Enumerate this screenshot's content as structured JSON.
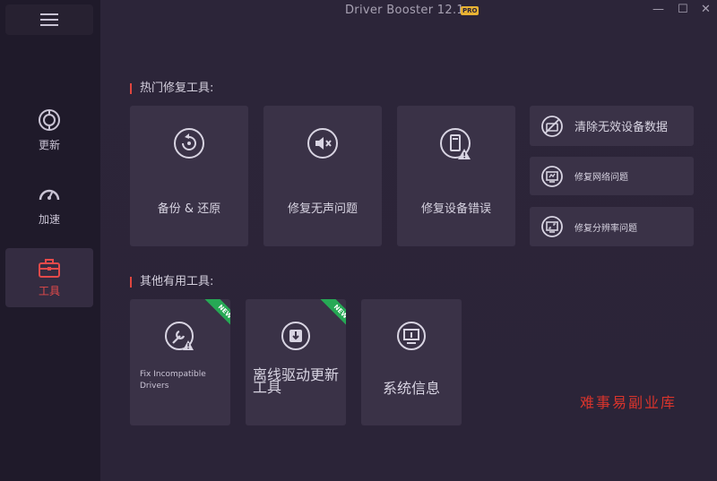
{
  "titlebar": {
    "app_title": "Driver Booster 12.1",
    "pro_badge": "PRO",
    "minimize": "—",
    "maximize": "☐",
    "close": "✕"
  },
  "sidebar": {
    "menu_icon": "hamburger-icon",
    "items": [
      {
        "label": "更新",
        "icon": "update-icon",
        "active": false
      },
      {
        "label": "加速",
        "icon": "speedometer-icon",
        "active": false
      },
      {
        "label": "工具",
        "icon": "toolbox-icon",
        "active": true
      }
    ]
  },
  "sections": {
    "hot_tools_title": "热门修复工具:",
    "other_tools_title": "其他有用工具:"
  },
  "hot_tools": [
    {
      "label": "备份 & 还原",
      "icon": "backup-restore-icon"
    },
    {
      "label": "修复无声问题",
      "icon": "sound-mute-icon"
    },
    {
      "label": "修复设备错误",
      "icon": "device-error-icon"
    }
  ],
  "side_tools": [
    {
      "label": "清除无效设备数据",
      "icon": "clean-device-icon"
    },
    {
      "label": "修复网络问题",
      "icon": "network-fix-icon"
    },
    {
      "label": "修复分辨率问题",
      "icon": "resolution-fix-icon"
    }
  ],
  "other_tools": [
    {
      "label": "Fix Incompatible Drivers",
      "icon": "fix-driver-icon",
      "badge": "NEW"
    },
    {
      "label": "离线驱动更新工具",
      "icon": "offline-update-icon",
      "badge": "NEW"
    },
    {
      "label": "系统信息",
      "icon": "system-info-icon",
      "badge": ""
    }
  ],
  "watermark": "难事易副业库",
  "colors": {
    "accent_red": "#e0463f",
    "badge_green": "#26a955",
    "pro_gold": "#e8b233",
    "card_bg": "#3a3247"
  }
}
